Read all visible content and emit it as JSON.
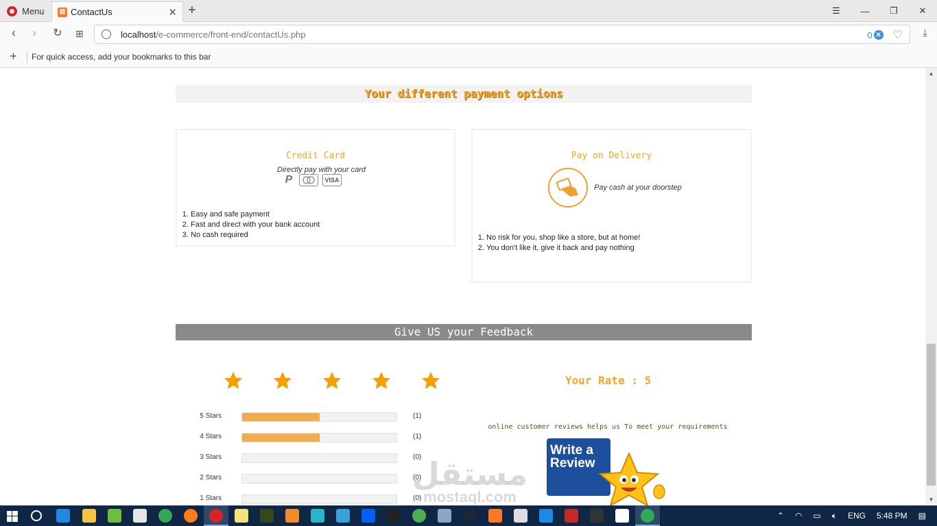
{
  "browser": {
    "menu_label": "Menu",
    "tab_title": "ContactUs",
    "url_host": "localhost",
    "url_path": "/e-commerce/front-end/contactUs.php",
    "adblock_count": "0",
    "bookmarks_hint": "For quick access, add your bookmarks to this bar"
  },
  "payment": {
    "header": "Your different payment options",
    "credit_card": {
      "title": "Credit Card",
      "subtitle": "Directly pay with your card",
      "icons": [
        "paypal-icon",
        "mastercard-icon",
        "visa-icon"
      ],
      "visa_text": "VISA",
      "items": [
        "Easy and safe payment",
        "Fast and direct with your bank account",
        "No cash required"
      ]
    },
    "delivery": {
      "title": "Pay on Delivery",
      "subtitle": "Pay cash at your doorstep",
      "items": [
        "No risk for you, shop like a store, but at home!",
        "You don't like it, give it back and pay nothing"
      ]
    }
  },
  "feedback": {
    "header": "Give US your Feedback",
    "star_count": 5,
    "rate_label": "Your Rate : 5",
    "reviews_message": "online customer reviews helps us To meet your requirements",
    "write_review_line1": "Write a",
    "write_review_line2": "Review",
    "rating_rows": [
      {
        "label": "5 Stars",
        "count": "(1)",
        "fill": 0.5
      },
      {
        "label": "4 Stars",
        "count": "(1)",
        "fill": 0.5
      },
      {
        "label": "3 Stars",
        "count": "(0)",
        "fill": 0
      },
      {
        "label": "2 Stars",
        "count": "(0)",
        "fill": 0
      },
      {
        "label": "1 Stars",
        "count": "(0)",
        "fill": 0
      }
    ]
  },
  "watermark": {
    "arabic": "مستقل",
    "latin": "mostaql.com"
  },
  "taskbar": {
    "language": "ENG",
    "time": "5:48 PM"
  },
  "colors": {
    "accent": "#f5a623",
    "header_gray": "#8a8a8a",
    "bar_fill": "#f0ad4e",
    "taskbar": "#0f2745"
  }
}
